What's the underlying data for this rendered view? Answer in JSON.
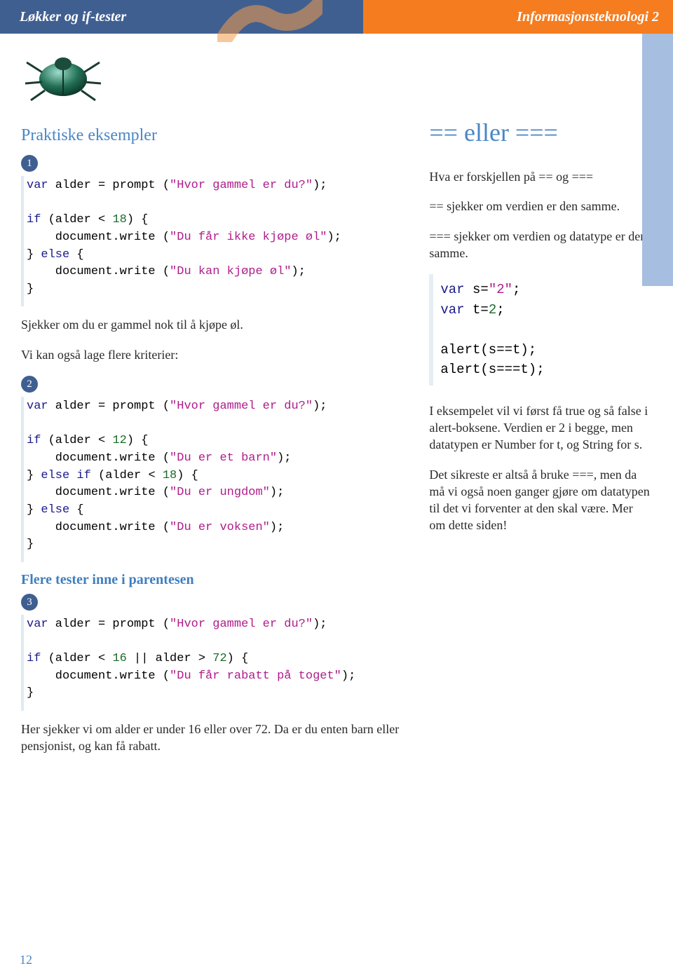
{
  "header": {
    "left": "Løkker og if-tester",
    "right": "Informasjonsteknologi 2"
  },
  "main": {
    "section_title": "Praktiske eksempler",
    "badges": {
      "b1": "1",
      "b2": "2",
      "b3": "3"
    },
    "code1": {
      "l1a": "var",
      "l1b": " alder = prompt (",
      "l1c": "\"Hvor gammel er du?\"",
      "l1d": ");",
      "l3a": "if",
      "l3b": " (alder < ",
      "l3c": "18",
      "l3d": ") {",
      "l4a": "    document.write (",
      "l4b": "\"Du får ikke kjøpe øl\"",
      "l4c": ");",
      "l5a": "} ",
      "l5b": "else",
      "l5c": " {",
      "l6a": "    document.write (",
      "l6b": "\"Du kan kjøpe øl\"",
      "l6c": ");",
      "l7": "}"
    },
    "p_after1": "Sjekker om du er gammel nok til å kjøpe øl.",
    "p_before2": "Vi kan også lage flere kriterier:",
    "code2": {
      "l1a": "var",
      "l1b": " alder = prompt (",
      "l1c": "\"Hvor gammel er du?\"",
      "l1d": ");",
      "l3a": "if",
      "l3b": " (alder < ",
      "l3c": "12",
      "l3d": ") {",
      "l4a": "    document.write (",
      "l4b": "\"Du er et barn\"",
      "l4c": ");",
      "l5a": "} ",
      "l5b": "else if",
      "l5c": " (alder < ",
      "l5d": "18",
      "l5e": ") {",
      "l6a": "    document.write (",
      "l6b": "\"Du er ungdom\"",
      "l6c": ");",
      "l7a": "} ",
      "l7b": "else",
      "l7c": " {",
      "l8a": "    document.write (",
      "l8b": "\"Du er voksen\"",
      "l8c": ");",
      "l9": "}"
    },
    "sub_title": "Flere tester inne i parentesen",
    "code3": {
      "l1a": "var",
      "l1b": " alder = prompt (",
      "l1c": "\"Hvor gammel er du?\"",
      "l1d": ");",
      "l3a": "if",
      "l3b": " (alder < ",
      "l3c": "16",
      "l3d": " || alder > ",
      "l3e": "72",
      "l3f": ") {",
      "l4a": "    document.write (",
      "l4b": "\"Du får rabatt på toget\"",
      "l4c": ");",
      "l5": "}"
    },
    "p_after3": "Her sjekker vi om alder er under 16 eller over 72. Da er du enten barn eller pensjonist, og kan få rabatt."
  },
  "side": {
    "heading": "== eller ===",
    "p1": "Hva er forskjellen på == og ===",
    "p2": "== sjekker om verdien er den samme.",
    "p3": "=== sjekker om verdien og datatype er den samme.",
    "code": {
      "l1a": "var",
      "l1b": " s=",
      "l1c": "\"2\"",
      "l1d": ";",
      "l2a": "var",
      "l2b": " t=",
      "l2c": "2",
      "l2d": ";",
      "l4": "alert(s==t);",
      "l5": "alert(s===t);"
    },
    "p4": "I eksempelet vil vi først få true og så false i alert-boksene. Verdien er 2 i begge, men datatypen er Number for t, og String for s.",
    "p5": "Det sikreste er altså å bruke ===, men da må vi også noen ganger gjøre om datatypen til det vi forventer at den skal være. Mer om dette siden!"
  },
  "page_num": "12"
}
